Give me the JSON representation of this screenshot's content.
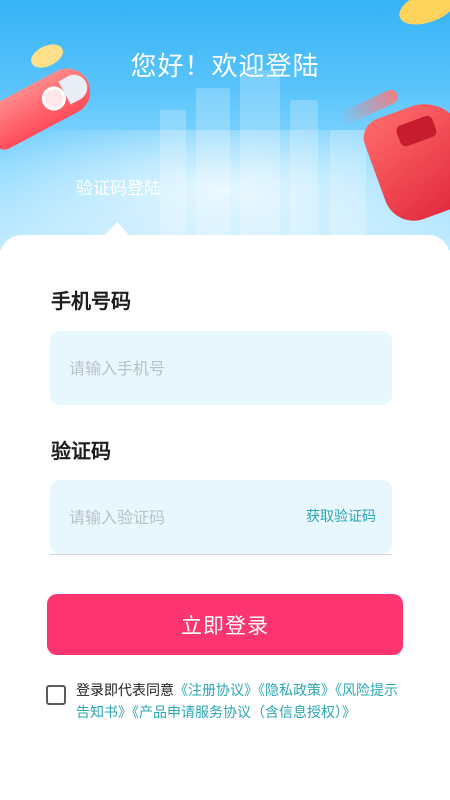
{
  "header": {
    "greeting": "您好！欢迎登陆",
    "tab_label": "验证码登陆"
  },
  "form": {
    "phone": {
      "label": "手机号码",
      "placeholder": "请输入手机号",
      "value": ""
    },
    "code": {
      "label": "验证码",
      "placeholder": "请输入验证码",
      "value": "",
      "get_code_label": "获取验证码"
    },
    "submit_label": "立即登录"
  },
  "agreement": {
    "checked": false,
    "prefix": "登录即代表同意",
    "links": [
      "《注册协议》",
      "《隐私政策》",
      "《风险提示告知书》",
      "《产品申请服务协议（含信息授权）》"
    ]
  },
  "colors": {
    "primary_button": "#fc3570",
    "link": "#2aa6b5",
    "input_bg": "#e8f6fd",
    "header_blue": "#36b2f5"
  }
}
